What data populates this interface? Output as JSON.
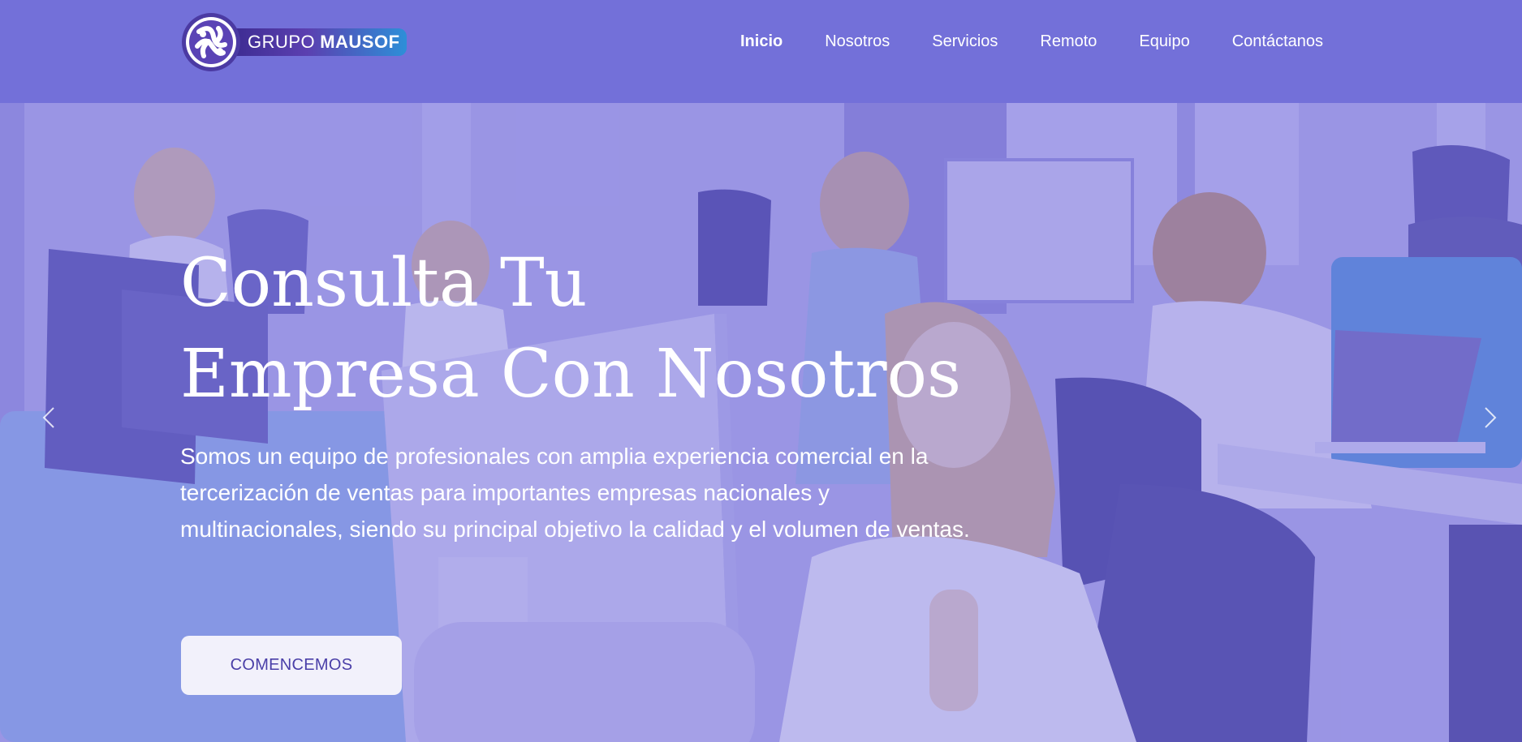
{
  "brand": {
    "name_light": "GRUPO",
    "name_bold": "MAUSOF",
    "gradient_colors": [
      "#3a2a8f",
      "#5b3fb0",
      "#2d8fd8"
    ],
    "logo_icon": "knot-emblem-icon"
  },
  "nav": {
    "items": [
      {
        "label": "Inicio",
        "active": true
      },
      {
        "label": "Nosotros",
        "active": false
      },
      {
        "label": "Servicios",
        "active": false
      },
      {
        "label": "Remoto",
        "active": false
      },
      {
        "label": "Equipo",
        "active": false
      },
      {
        "label": "Contáctanos",
        "active": false
      }
    ]
  },
  "hero": {
    "title_line1": "Consulta Tu",
    "title_line2": "Empresa Con Nosotros",
    "description": "Somos un equipo de profesionales con amplia experiencia comercial en la tercerización de ventas para importantes empresas nacionales y multinacionales, siendo su principal objetivo la calidad y el volumen de ventas.",
    "cta_label": "COMENCEMOS",
    "prev_icon": "chevron-left-icon",
    "next_icon": "chevron-right-icon"
  },
  "colors": {
    "nav_background": "#7370d9",
    "overlay": "#7d76de",
    "cta_background": "#f2f1fb",
    "cta_text": "#4a3fa8"
  }
}
